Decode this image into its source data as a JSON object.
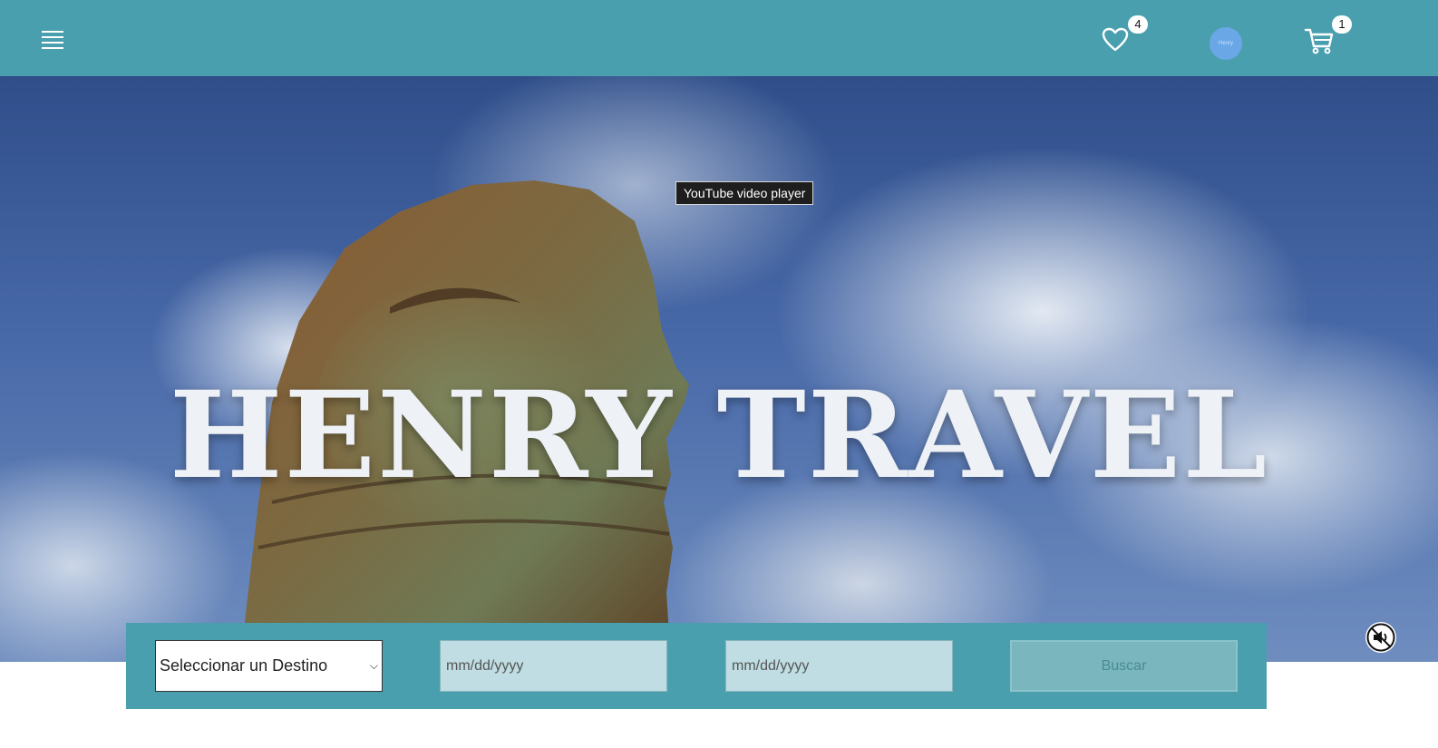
{
  "navbar": {
    "menu_icon": "hamburger-menu-icon",
    "favorites_icon": "heart-icon",
    "favorites_count": "4",
    "avatar_text": "Henry",
    "cart_icon": "shopping-cart-icon",
    "cart_count": "1",
    "background_color": "#4a9faf"
  },
  "hero": {
    "title": "HENRY TRAVEL",
    "video_tooltip": "YouTube video player",
    "mute_icon": "muted-speaker-icon"
  },
  "search": {
    "destination_placeholder": "Seleccionar un Destino",
    "date_from_placeholder": "mm/dd/yyyy",
    "date_to_placeholder": "mm/dd/yyyy",
    "search_button": "Buscar"
  }
}
